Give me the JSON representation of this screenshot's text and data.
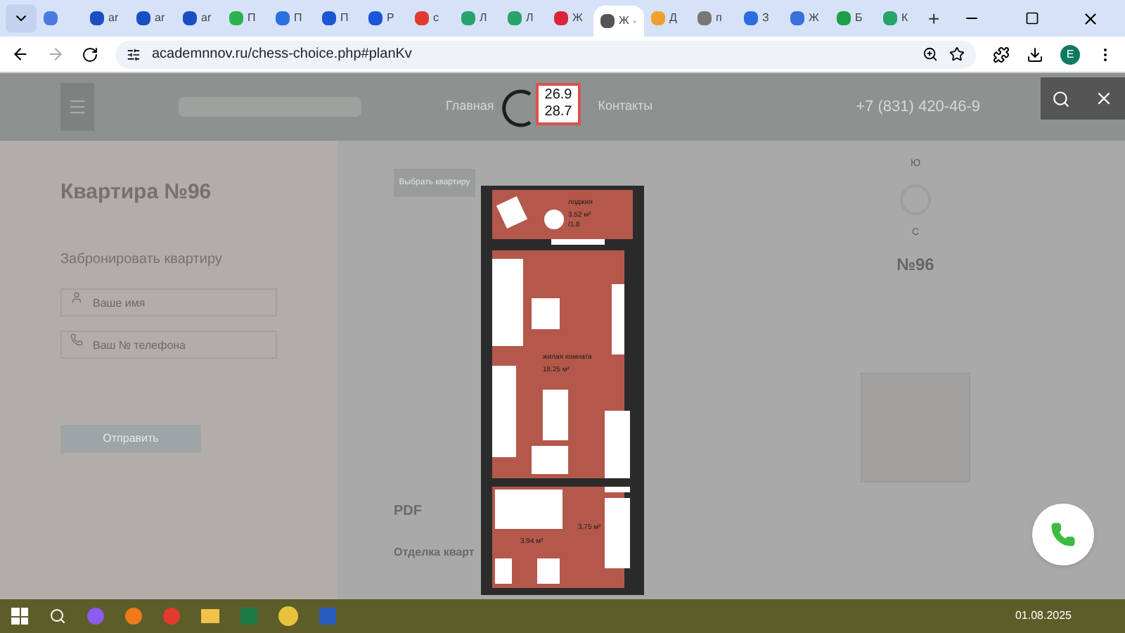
{
  "browser": {
    "tabs": [
      {
        "color": "#4a7be0",
        "selected": false
      },
      {
        "label": "ar",
        "color": "#1a4fc4",
        "selected": false
      },
      {
        "label": "ar",
        "color": "#1a4fc4",
        "selected": false
      },
      {
        "label": "ar",
        "color": "#1a4fc4",
        "selected": false
      },
      {
        "label": "П",
        "color": "#2bb24c",
        "selected": false
      },
      {
        "label": "П",
        "color": "#2a6fe0",
        "selected": false
      },
      {
        "label": "П",
        "color": "#1a56d6",
        "selected": false
      },
      {
        "label": "Р",
        "color": "#1a56d6",
        "selected": false
      },
      {
        "label": "с",
        "color": "#e03a2f",
        "selected": false
      },
      {
        "label": "Л",
        "color": "#27a36b",
        "selected": false
      },
      {
        "label": "Л",
        "color": "#27a36b",
        "selected": false
      },
      {
        "label": "Ж",
        "color": "#d9263a",
        "selected": false
      },
      {
        "label": "Ж",
        "color": "#555555",
        "selected": true
      },
      {
        "label": "Д",
        "color": "#f0a030",
        "selected": false
      },
      {
        "label": "п",
        "color": "#777777",
        "selected": false
      },
      {
        "label": "З",
        "color": "#2a6fe0",
        "selected": false
      },
      {
        "label": "Ж",
        "color": "#3b6fd9",
        "selected": false
      },
      {
        "label": "Б",
        "color": "#1f9e45",
        "selected": false
      },
      {
        "label": "К",
        "color": "#27a36b",
        "selected": false
      }
    ],
    "new_tab": "+",
    "address": "academnnov.ru/chess-choice.php#planKv",
    "profile": "E"
  },
  "site": {
    "nav": [
      "Главная",
      "Контакты"
    ],
    "phone": "+7 (831) 420-46-9",
    "title": "Квартира №96",
    "booking_title": "Забронировать квартиру",
    "fields": [
      {
        "kind": "person",
        "placeholder": "Ваше имя"
      },
      {
        "kind": "phone",
        "placeholder": "Ваш № телефона"
      }
    ],
    "submit": "Отправить",
    "choose_button": "Выбрать квартиру",
    "pdf": "PDF",
    "finish_title": "Отделка кварт",
    "compass": {
      "top": "Ю",
      "bottom": "С"
    },
    "apartment_number": "№96"
  },
  "viewer": {
    "readings": [
      "26.9",
      "28.7"
    ],
    "rooms": [
      {
        "name": "лоджия",
        "area": "3.52 м²",
        "note": "/1.8"
      },
      {
        "name": "жилая комната",
        "area": "18.25 м²"
      },
      {
        "area": "3.75 м²"
      },
      {
        "area": "3.94 м²"
      }
    ]
  },
  "taskbar": {
    "date": "01.08.2025"
  }
}
